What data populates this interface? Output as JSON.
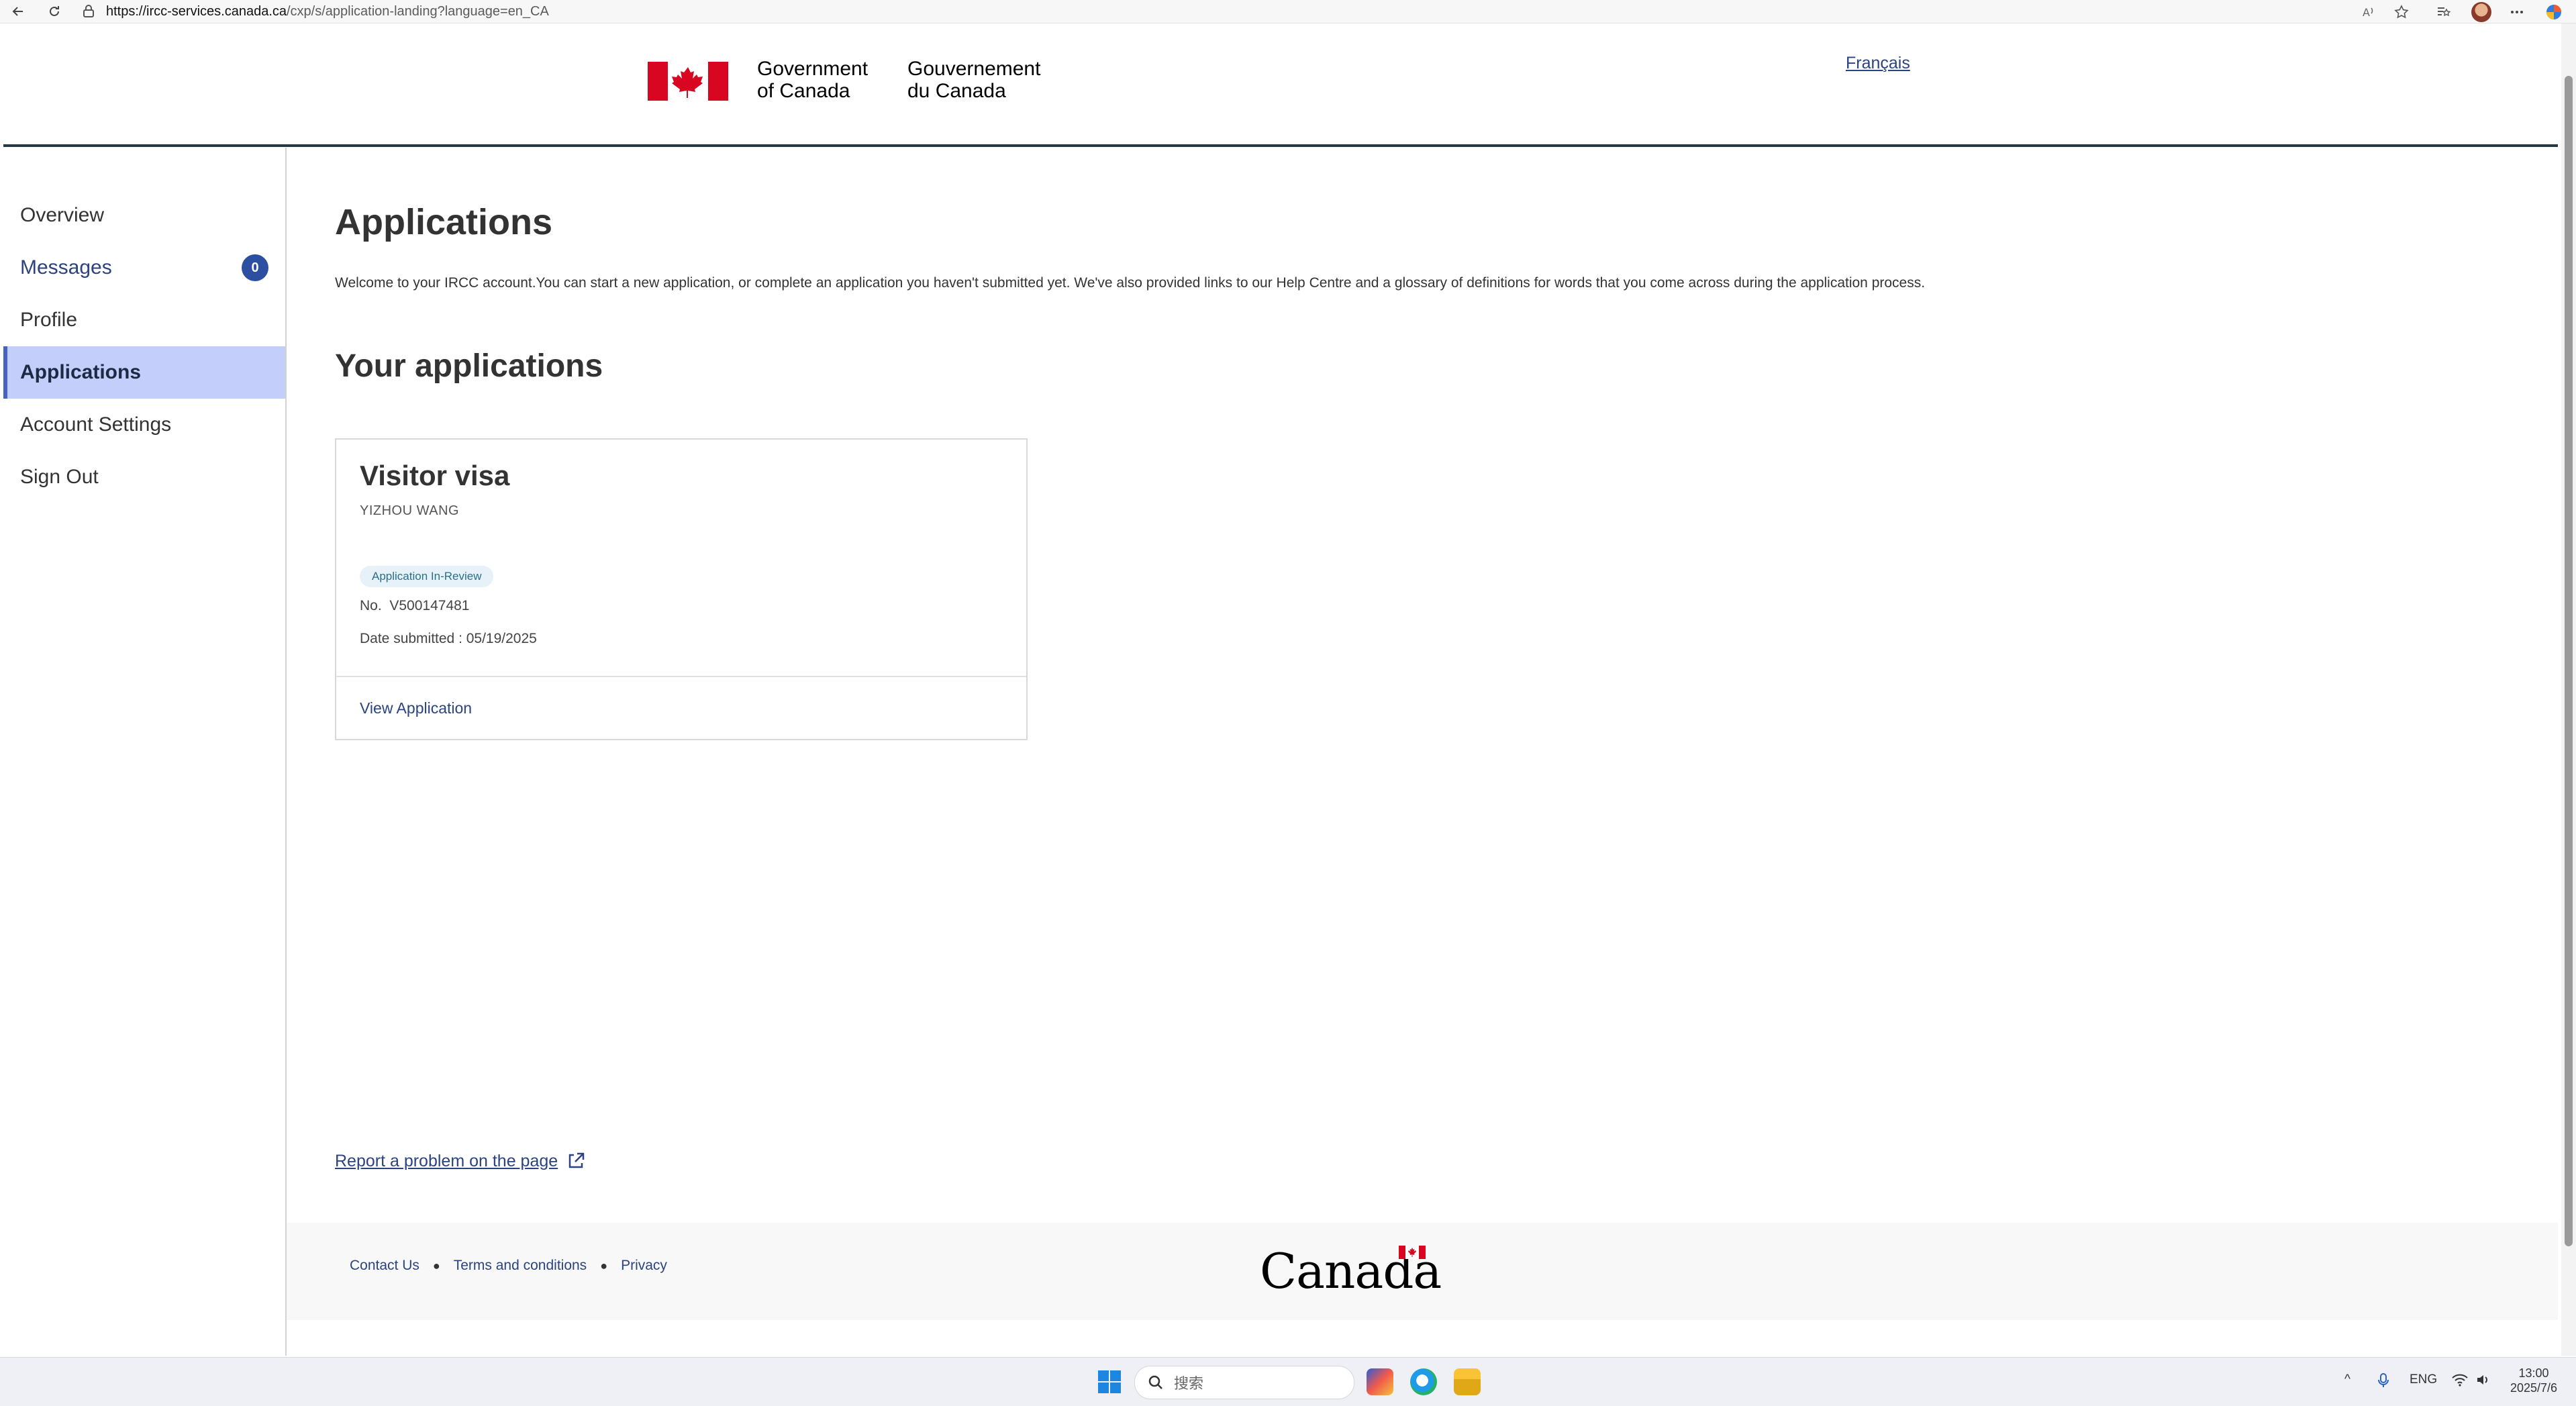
{
  "browser": {
    "url_host": "https://ircc-services.canada.ca",
    "url_path": "/cxp/s/application-landing?language=en_CA"
  },
  "header": {
    "sig_en_line1": "Government",
    "sig_en_line2": "of Canada",
    "sig_fr_line1": "Gouvernement",
    "sig_fr_line2": "du Canada",
    "language_toggle": "Français"
  },
  "sidebar": {
    "items": [
      {
        "label": "Overview"
      },
      {
        "label": "Messages",
        "badge": "0"
      },
      {
        "label": "Profile"
      },
      {
        "label": "Applications"
      },
      {
        "label": "Account Settings"
      },
      {
        "label": "Sign Out"
      }
    ]
  },
  "main": {
    "title": "Applications",
    "welcome": "Welcome to your IRCC account.You can start a new application, or complete an application you haven't submitted yet. We've also provided links to our Help Centre and a glossary of definitions for words that you come across during the application process.",
    "section_title": "Your applications",
    "card": {
      "title": "Visitor visa",
      "applicant": "YIZHOU WANG",
      "status": "Application In-Review",
      "number_label": "No.",
      "number": "V500147481",
      "date_submitted": "Date submitted : 05/19/2025",
      "view_link": "View Application"
    },
    "report_link": "Report a problem on the page"
  },
  "footer": {
    "links": [
      "Contact Us",
      "Terms and conditions",
      "Privacy"
    ],
    "wordmark": "Canada"
  },
  "taskbar": {
    "search_placeholder": "搜索",
    "lang": "ENG",
    "time": "13:00",
    "date": "2025/7/6"
  },
  "colors": {
    "link": "#2b4380",
    "active_nav_bg": "#c3cefa",
    "header_rule": "#26374a",
    "flag_red": "#d80621"
  }
}
